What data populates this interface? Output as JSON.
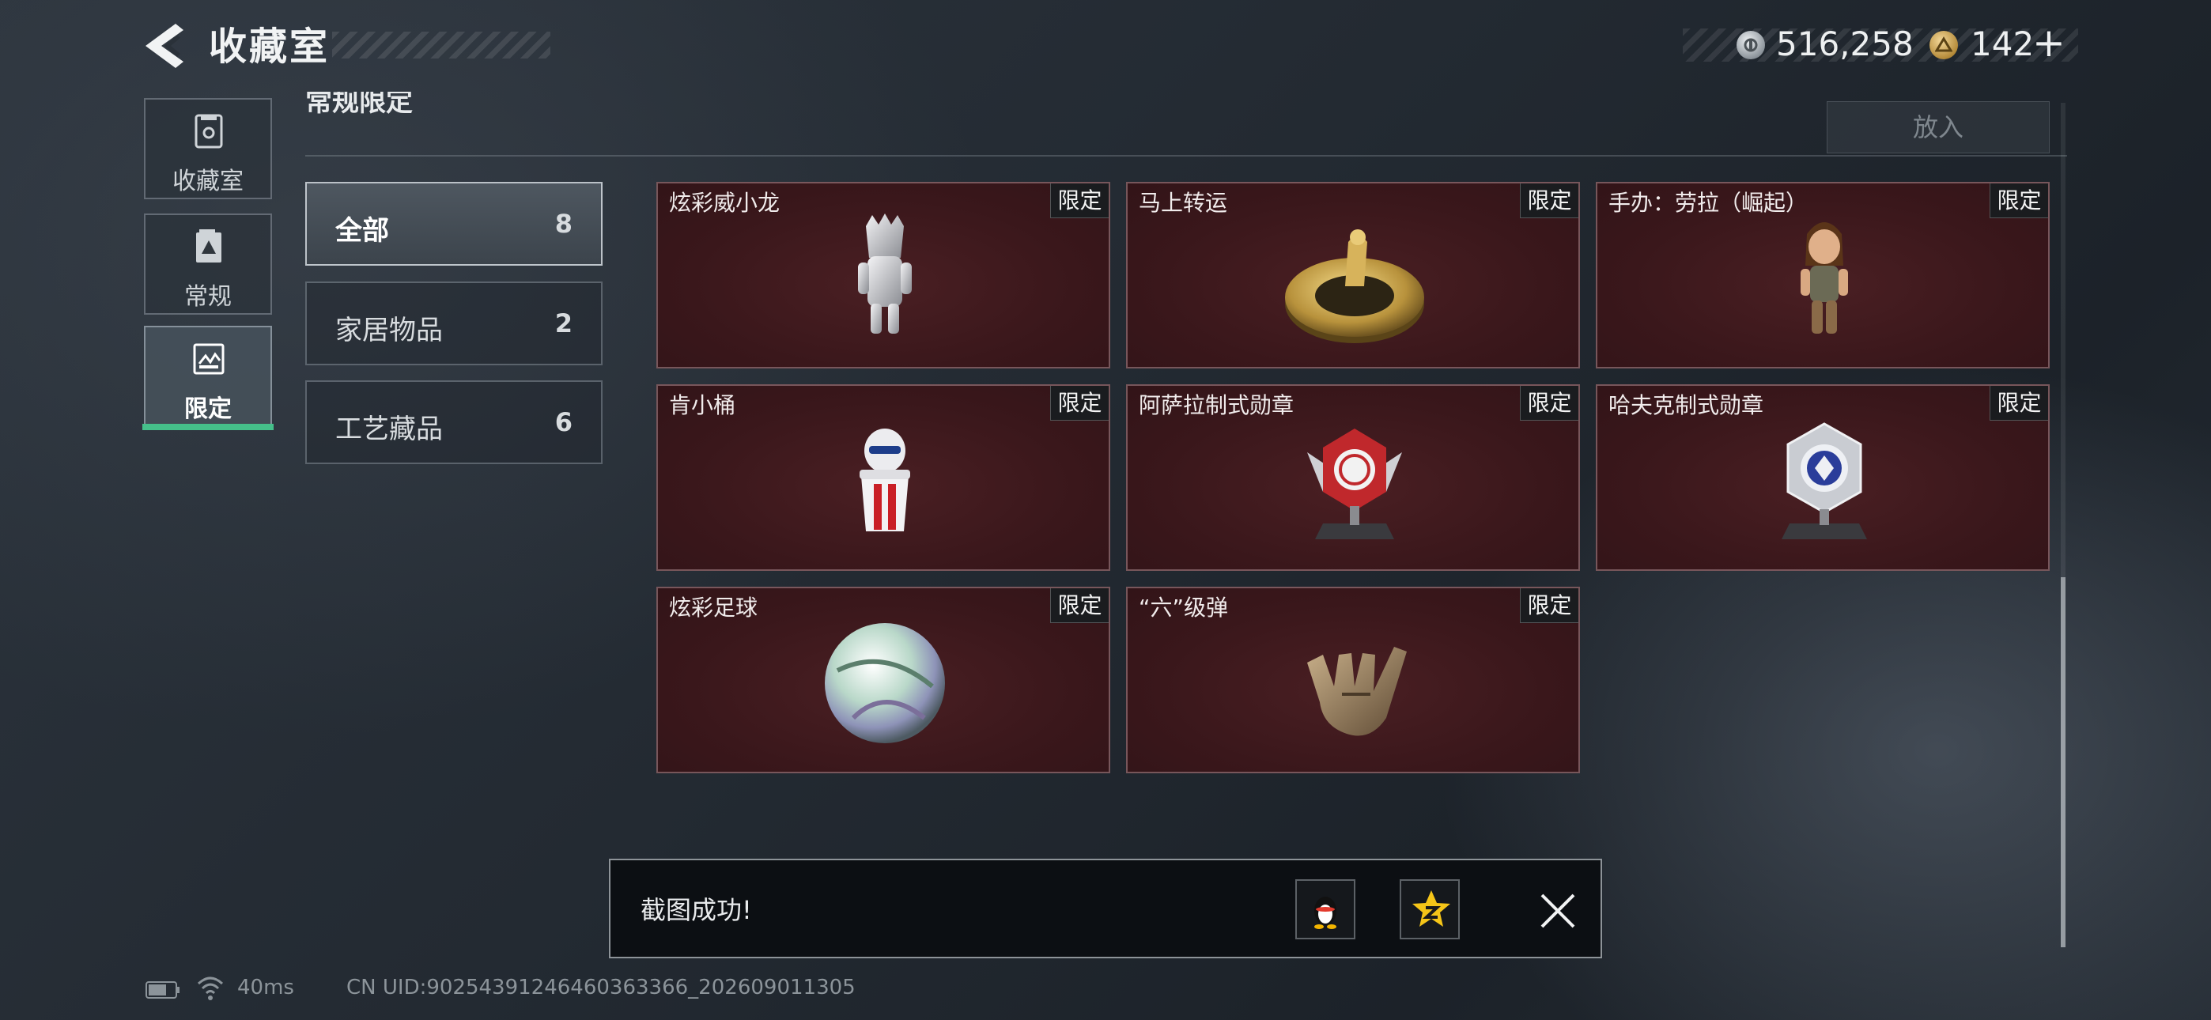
{
  "header": {
    "title": "收藏室",
    "currencies": [
      {
        "icon": "silver-coin-icon",
        "value": "516,258"
      },
      {
        "icon": "gold-coin-icon",
        "value": "142"
      }
    ],
    "add_label": "+"
  },
  "nav": {
    "items": [
      {
        "label": "收藏室",
        "icon": "collection-room-icon",
        "selected": false
      },
      {
        "label": "常规",
        "icon": "regular-icon",
        "selected": false
      },
      {
        "label": "限定",
        "icon": "limited-icon",
        "selected": true
      }
    ],
    "selected_accent": "#45c08a"
  },
  "section": {
    "title": "常规限定",
    "put_button": "放入"
  },
  "filters": [
    {
      "label": "全部",
      "count": "8",
      "selected": true
    },
    {
      "label": "家居物品",
      "count": "2",
      "selected": false
    },
    {
      "label": "工艺藏品",
      "count": "6",
      "selected": false
    }
  ],
  "items": [
    {
      "name": "炫彩威小龙",
      "badge": "限定",
      "icon": "silver-dragon-figure-icon"
    },
    {
      "name": "马上转运",
      "badge": "限定",
      "icon": "golden-horse-turntable-icon"
    },
    {
      "name": "手办：劳拉（崛起）",
      "badge": "限定",
      "icon": "lara-figure-icon"
    },
    {
      "name": "肯小桶",
      "badge": "限定",
      "icon": "kfc-bucket-figure-icon"
    },
    {
      "name": "阿萨拉制式勋章",
      "badge": "限定",
      "icon": "asara-medal-icon"
    },
    {
      "name": "哈夫克制式勋章",
      "badge": "限定",
      "icon": "haavk-medal-icon"
    },
    {
      "name": "炫彩足球",
      "badge": "限定",
      "icon": "iridescent-football-icon"
    },
    {
      "name": "“六”级弹",
      "badge": "限定",
      "icon": "six-gesture-hand-icon"
    }
  ],
  "card_color": "#3a171b",
  "toast": {
    "message": "截图成功!",
    "share_targets": [
      "qq-icon",
      "qzone-icon"
    ]
  },
  "status": {
    "ping": "40ms",
    "uid": "CN UID:90254391246460363366_202609011305"
  }
}
